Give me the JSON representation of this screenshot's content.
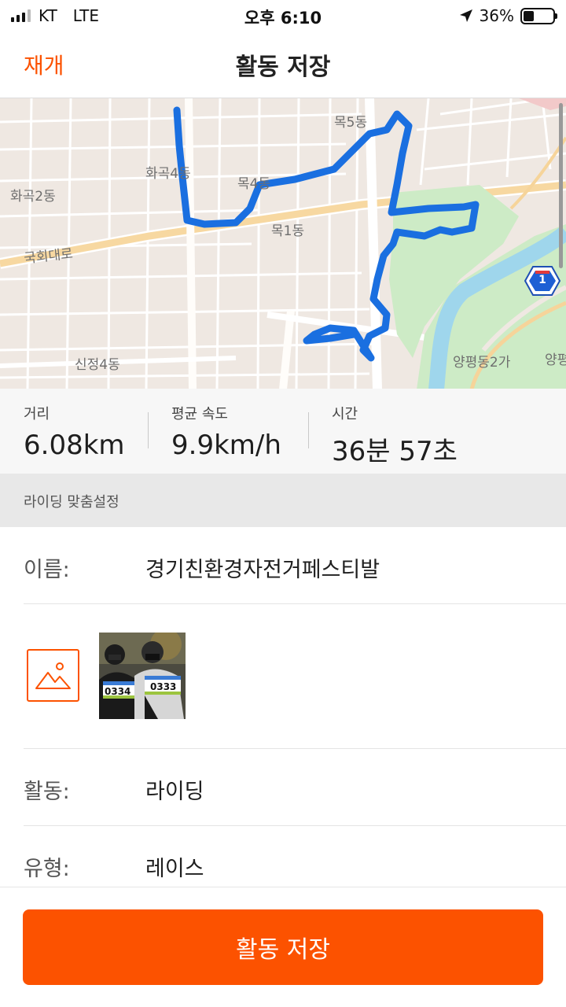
{
  "status_bar": {
    "carrier": "KT",
    "network": "LTE",
    "time": "오후 6:10",
    "battery_percent": "36%",
    "battery_level": 0.36,
    "location_icon": "location-arrow-icon"
  },
  "nav": {
    "resume_label": "재개",
    "title": "활동 저장"
  },
  "map": {
    "labels": {
      "mok5dong": "목5동",
      "hwagok4dong": "화곡4동",
      "mok4dong": "목4동",
      "hwagok2dong": "화곡2동",
      "mok1dong": "목1동",
      "gukhoedaero": "국회대로",
      "sinjeong4dong": "신정4동",
      "yangpyeong2ga": "양평동2가",
      "yang": "양평",
      "road_route": "1"
    },
    "route_color": "#1a6fe0",
    "park_color": "#cdebc6",
    "river_color": "#9fd6ec"
  },
  "stats": {
    "distance_label": "거리",
    "distance_value": "6.08km",
    "speed_label": "평균 속도",
    "speed_value": "9.9km/h",
    "time_label": "시간",
    "time_value": "36분 57초"
  },
  "section": {
    "ride_settings_label": "라이딩 맞춤설정"
  },
  "form": {
    "name_label": "이름:",
    "name_value": "경기친환경자전거페스티발",
    "bib_left": "0334",
    "bib_right": "0333",
    "activity_label": "활동:",
    "activity_value": "라이딩",
    "type_label": "유형:",
    "type_value": "레이스"
  },
  "footer": {
    "save_label": "활동 저장"
  },
  "colors": {
    "accent": "#fc5200"
  }
}
